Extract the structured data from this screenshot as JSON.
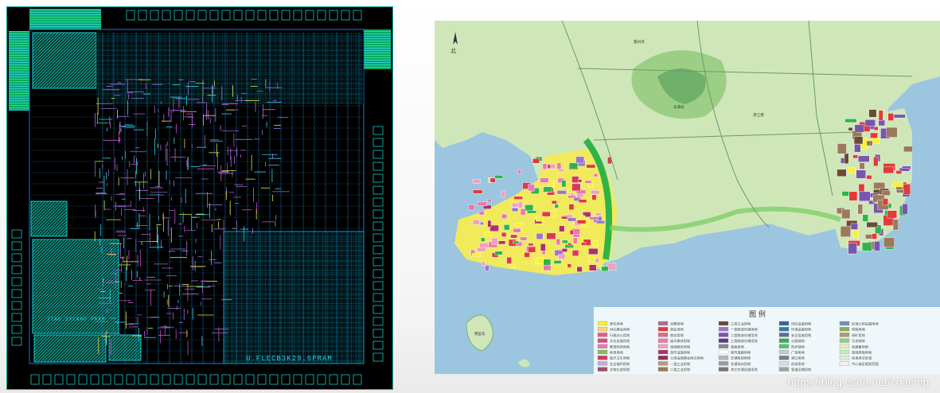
{
  "chip_layout": {
    "labels": [
      "U.FLECB3K29.6PRAM",
      "JTAG.3XCANG.PRAM"
    ]
  },
  "city_map": {
    "legend_title": "图  例",
    "legend_items": [
      {
        "label": "居住用地",
        "color": "#f5f233"
      },
      {
        "label": "村庄建设用地",
        "color": "#f7d76b"
      },
      {
        "label": "行政办公用地",
        "color": "#e85a8a"
      },
      {
        "label": "文化设施用地",
        "color": "#d44f7a"
      },
      {
        "label": "教育科研用地",
        "color": "#e978b0"
      },
      {
        "label": "体育用地",
        "color": "#7fbf5a"
      },
      {
        "label": "医疗卫生用地",
        "color": "#d83a55"
      },
      {
        "label": "社会福利用地",
        "color": "#c9a8d6"
      },
      {
        "label": "文物古迹用地",
        "color": "#a84b6b"
      },
      {
        "label": "宗教用地",
        "color": "#b66b8f"
      },
      {
        "label": "商业用地",
        "color": "#e23a3a"
      },
      {
        "label": "商务用地",
        "color": "#d96b8c"
      },
      {
        "label": "娱乐康体用地",
        "color": "#e57da2"
      },
      {
        "label": "旅游服务用地",
        "color": "#f0a0c0"
      },
      {
        "label": "游乐设施用地",
        "color": "#b0306a"
      },
      {
        "label": "公用设施营业网点用地",
        "color": "#8b3355"
      },
      {
        "label": "一类工业用地",
        "color": "#b89a7a"
      },
      {
        "label": "二类工业用地",
        "color": "#9a7a5a"
      },
      {
        "label": "三类工业用地",
        "color": "#6b4a35"
      },
      {
        "label": "一类物流仓储用地",
        "color": "#9b77c7"
      },
      {
        "label": "二类物流仓储用地",
        "color": "#7a55b0"
      },
      {
        "label": "三类物流仓储用地",
        "color": "#5a3a8a"
      },
      {
        "label": "铁路用地",
        "color": "#888888"
      },
      {
        "label": "城市道路用地",
        "color": "#ffffff"
      },
      {
        "label": "交通枢纽用地",
        "color": "#b5b5b5"
      },
      {
        "label": "交通场站用地",
        "color": "#9a9a9a"
      },
      {
        "label": "其它交通设施用地",
        "color": "#777777"
      },
      {
        "label": "供应设施用地",
        "color": "#3a5faa"
      },
      {
        "label": "环境设施用地",
        "color": "#2f7f8f"
      },
      {
        "label": "安全设施用地",
        "color": "#5a6f9f"
      },
      {
        "label": "公园绿地",
        "color": "#2fb34a"
      },
      {
        "label": "防护绿地",
        "color": "#55c26a"
      },
      {
        "label": "广场用地",
        "color": "#c8c8c8"
      },
      {
        "label": "港口用地",
        "color": "#7a7a9a"
      },
      {
        "label": "机场用地",
        "color": "#dcdcdc"
      },
      {
        "label": "管道运输用地",
        "color": "#a0a0a0"
      },
      {
        "label": "区域公用设施用地",
        "color": "#6f8fb5"
      },
      {
        "label": "特殊用地",
        "color": "#8faa55"
      },
      {
        "label": "采矿用地",
        "color": "#aa9977"
      },
      {
        "label": "生态绿地",
        "color": "#8fd07a"
      },
      {
        "label": "发展备用地",
        "color": "#e8e8c8"
      },
      {
        "label": "旅游度假用地",
        "color": "#c8e8b8"
      },
      {
        "label": "机场净空区域",
        "color": "#d8f0d0"
      },
      {
        "label": "中心城区规划范围",
        "color": "#f0f0f0"
      }
    ],
    "places": [
      "雷州湾",
      "湛江港",
      "东海岛",
      "南三岛",
      "特呈岛",
      "麻章",
      "坡头",
      "霞山",
      "赤坎"
    ]
  },
  "watermark": "https://blog.csdn.net/coachip"
}
